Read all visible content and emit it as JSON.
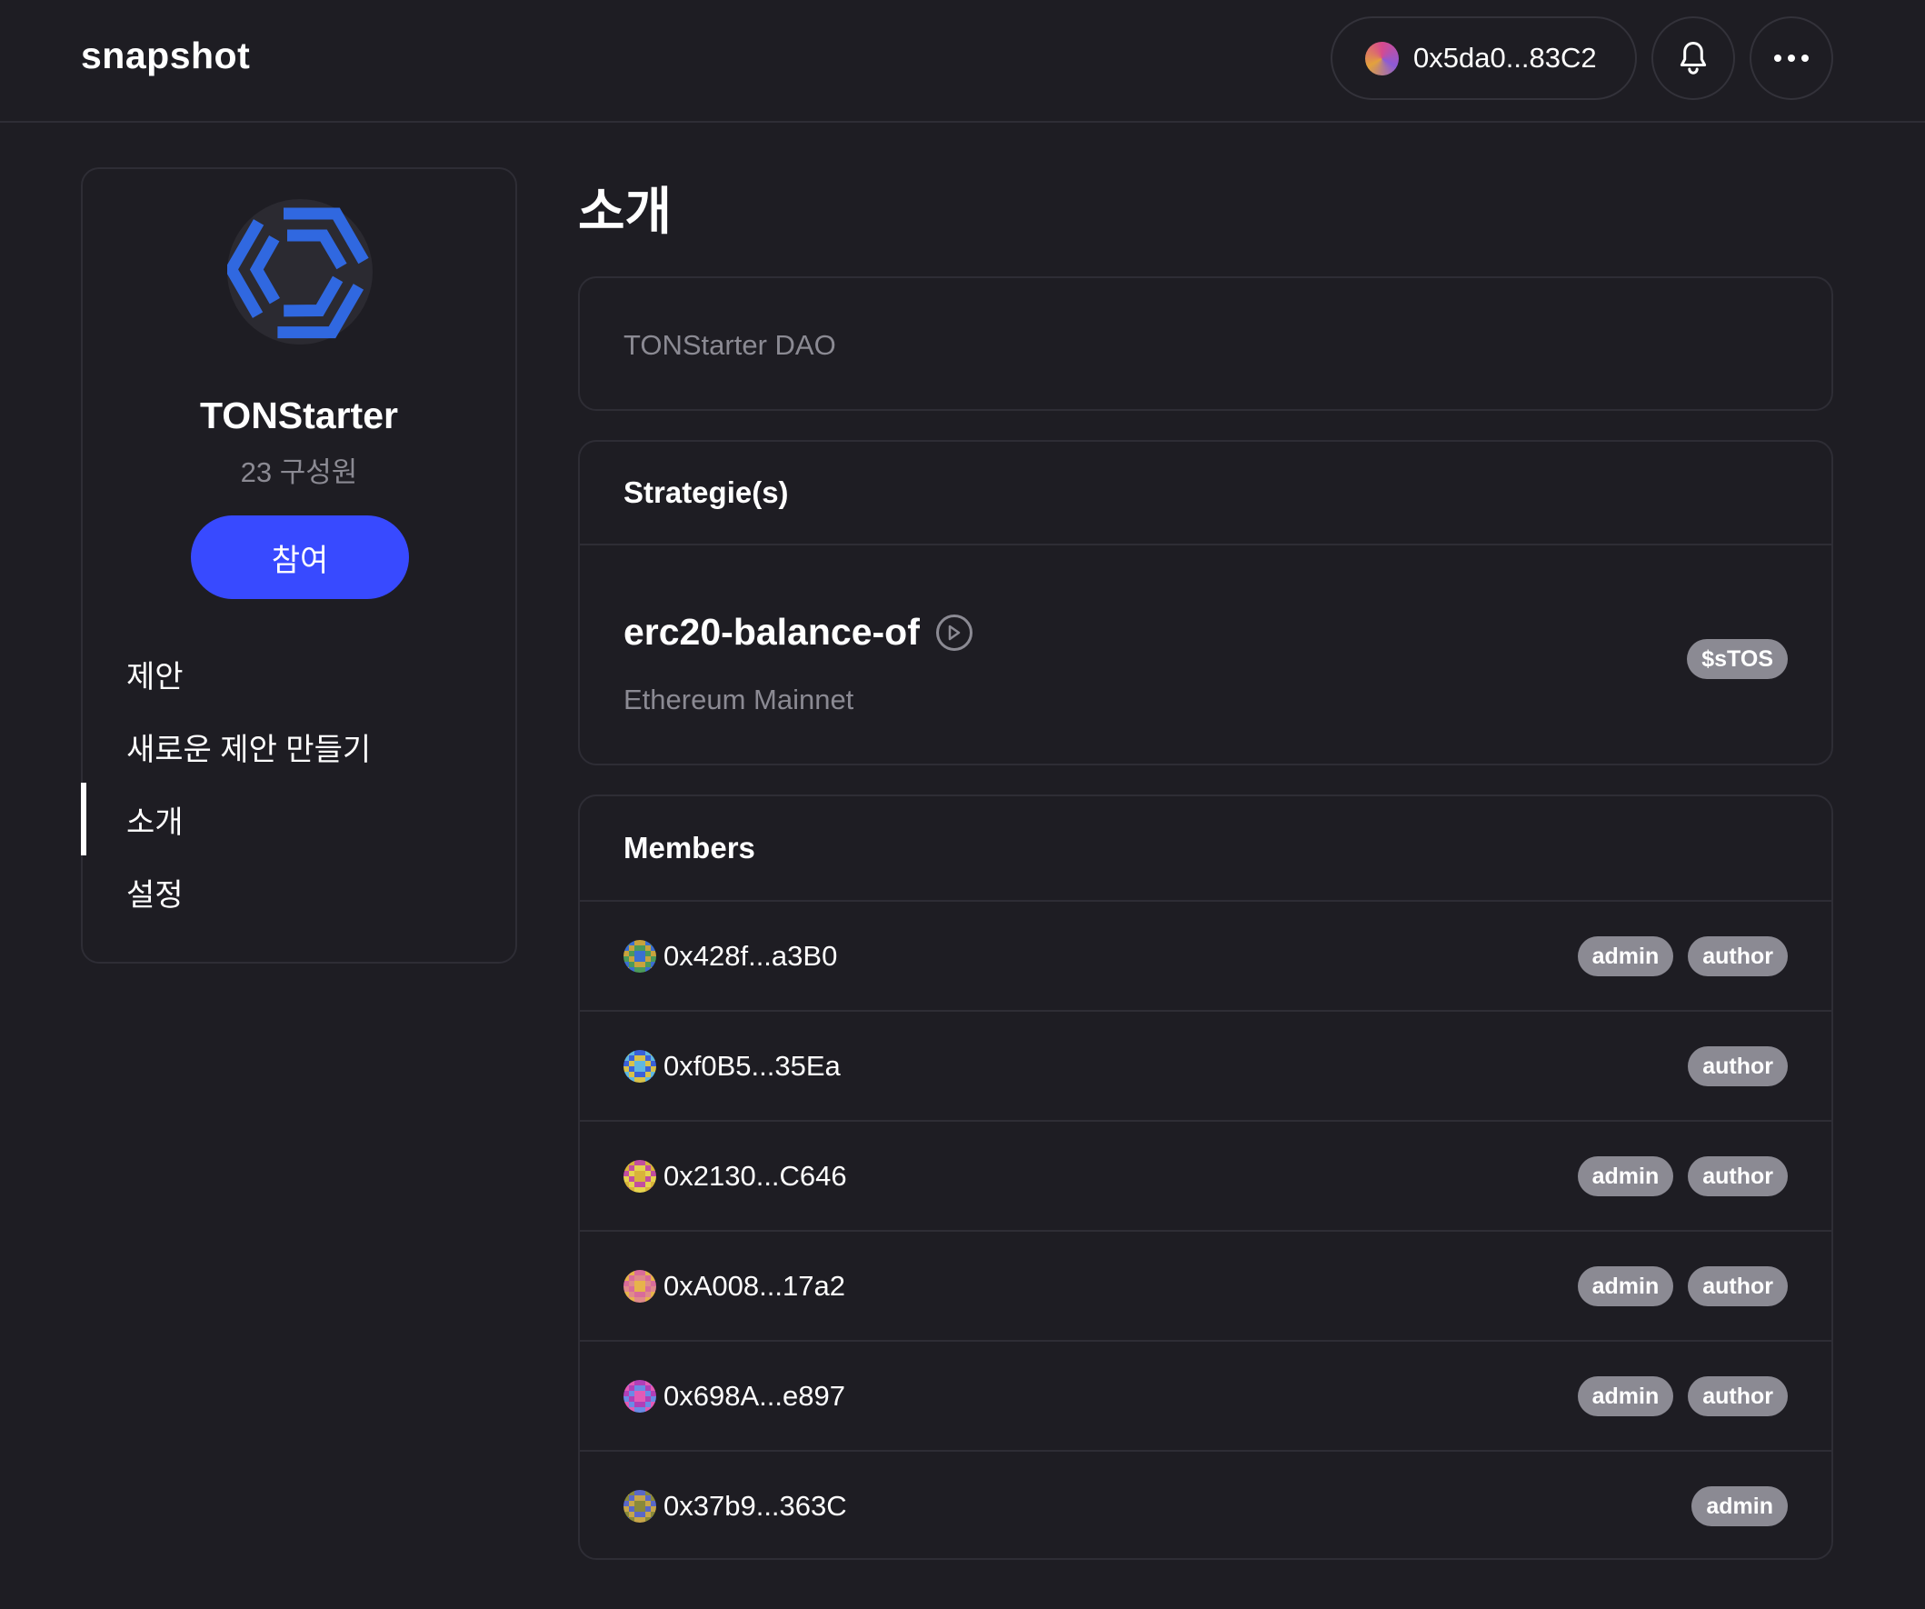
{
  "header": {
    "brand": "snapshot",
    "account": "0x5da0...83C2",
    "icons": {
      "bell": "bell-icon",
      "menu": "more-horizontal-icon"
    }
  },
  "sidebar": {
    "space_name": "TONStarter",
    "members_count": "23 구성원",
    "join_label": "참여",
    "nav": [
      {
        "label": "제안",
        "active": false
      },
      {
        "label": "새로운 제안 만들기",
        "active": false
      },
      {
        "label": "소개",
        "active": true
      },
      {
        "label": "설정",
        "active": false
      }
    ]
  },
  "main": {
    "title": "소개",
    "about": "TONStarter DAO",
    "strategies": {
      "heading": "Strategie(s)",
      "name": "erc20-balance-of",
      "network": "Ethereum Mainnet",
      "symbol": "$sTOS"
    },
    "members": {
      "heading": "Members",
      "rows": [
        {
          "address": "0x428f...a3B0",
          "roles": [
            "admin",
            "author"
          ],
          "colors": [
            "#4c9a5a",
            "#3b6fd1",
            "#c9a33d"
          ]
        },
        {
          "address": "0xf0B5...35Ea",
          "roles": [
            "author"
          ],
          "colors": [
            "#3a61d9",
            "#d8c24a",
            "#5fb7e0"
          ]
        },
        {
          "address": "0x2130...C646",
          "roles": [
            "admin",
            "author"
          ],
          "colors": [
            "#d9b33a",
            "#c24ea0",
            "#e6d34f"
          ]
        },
        {
          "address": "0xA008...17a2",
          "roles": [
            "admin",
            "author"
          ],
          "colors": [
            "#e08a8a",
            "#e7b34b",
            "#d96c9a"
          ]
        },
        {
          "address": "0x698A...e897",
          "roles": [
            "admin",
            "author"
          ],
          "colors": [
            "#b13fb8",
            "#6a8be6",
            "#e35ab6"
          ]
        },
        {
          "address": "0x37b9...363C",
          "roles": [
            "admin"
          ],
          "colors": [
            "#8a8a3a",
            "#5a68c8",
            "#c7a64a"
          ]
        }
      ]
    }
  },
  "colors": {
    "background": "#1e1d23",
    "border": "#2e2d35",
    "accent": "#384aff",
    "muted": "#8b8a93",
    "logo_blue": "#3068e0"
  }
}
